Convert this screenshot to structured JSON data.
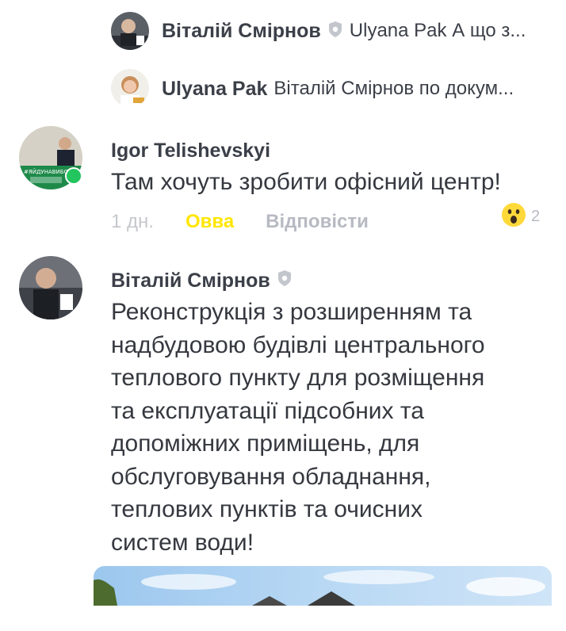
{
  "replies": [
    {
      "name": "Віталій Смірнов",
      "text": "Ulyana Pak А що з...",
      "verified": true
    },
    {
      "name": "Ulyana Pak",
      "text": "Віталій Смірнов  по докум...",
      "verified": false
    }
  ],
  "comments": [
    {
      "name": "Igor Telishevskyi",
      "text": "Там хочуть зробити офісний центр!",
      "time": "1 дн.",
      "wow_label": "Овва",
      "reply_label": "Відповісти",
      "reaction_count": "2",
      "online": true
    },
    {
      "name": "Віталій Смірнов",
      "verified": true,
      "text_lines": [
        "Реконструкція з розширенням та",
        "надбудовою будівлі центрального",
        "теплового пункту для розміщення",
        "та експлуатації підсобних та",
        "допоміжних приміщень, для",
        "обслуговування обладнання,",
        "теплових пунктів та очисних",
        "систем води!"
      ]
    }
  ],
  "avatar_badge_text": "#ЯЙДУНАВИБОРИ",
  "colors": {
    "wow": "#ffe600",
    "muted": "#b7bac2",
    "text": "#35383f",
    "online": "#22c55e"
  }
}
